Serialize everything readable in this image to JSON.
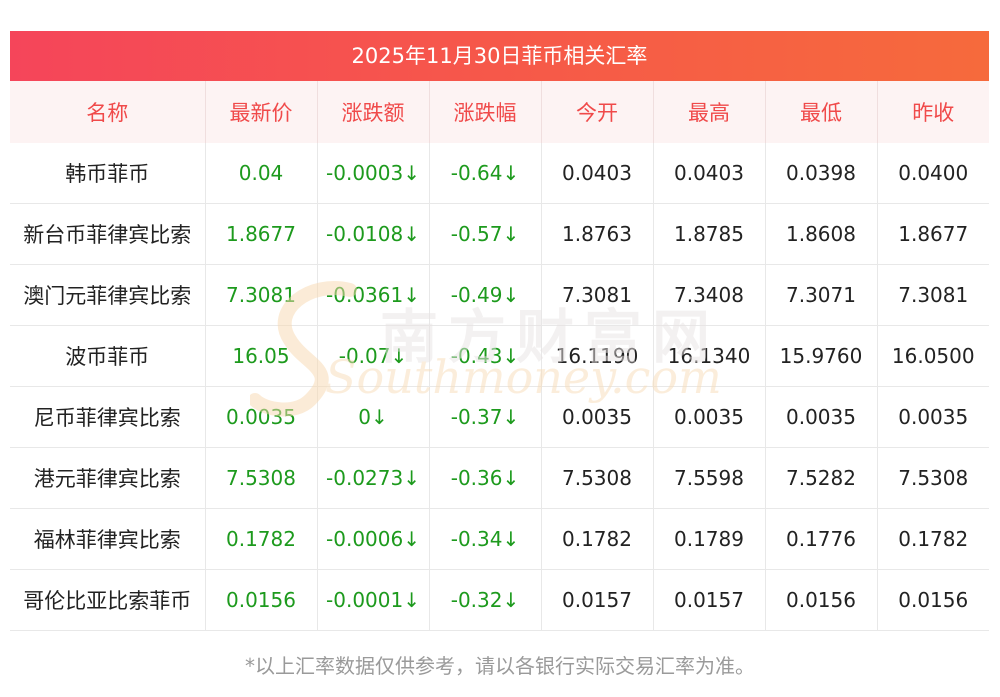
{
  "title": "2025年11月30日菲币相关汇率",
  "headers": [
    "名称",
    "最新价",
    "涨跌额",
    "涨跌幅",
    "今开",
    "最高",
    "最低",
    "昨收"
  ],
  "rows": [
    {
      "name": "韩币菲币",
      "latest": "0.04",
      "change": "-0.0003↓",
      "change_pct": "-0.64↓",
      "open": "0.0403",
      "high": "0.0403",
      "low": "0.0398",
      "prev_close": "0.0400"
    },
    {
      "name": "新台币菲律宾比索",
      "latest": "1.8677",
      "change": "-0.0108↓",
      "change_pct": "-0.57↓",
      "open": "1.8763",
      "high": "1.8785",
      "low": "1.8608",
      "prev_close": "1.8677"
    },
    {
      "name": "澳门元菲律宾比索",
      "latest": "7.3081",
      "change": "-0.0361↓",
      "change_pct": "-0.49↓",
      "open": "7.3081",
      "high": "7.3408",
      "low": "7.3071",
      "prev_close": "7.3081"
    },
    {
      "name": "波币菲币",
      "latest": "16.05",
      "change": "-0.07↓",
      "change_pct": "-0.43↓",
      "open": "16.1190",
      "high": "16.1340",
      "low": "15.9760",
      "prev_close": "16.0500"
    },
    {
      "name": "尼币菲律宾比索",
      "latest": "0.0035",
      "change": "0↓",
      "change_pct": "-0.37↓",
      "open": "0.0035",
      "high": "0.0035",
      "low": "0.0035",
      "prev_close": "0.0035"
    },
    {
      "name": "港元菲律宾比索",
      "latest": "7.5308",
      "change": "-0.0273↓",
      "change_pct": "-0.36↓",
      "open": "7.5308",
      "high": "7.5598",
      "low": "7.5282",
      "prev_close": "7.5308"
    },
    {
      "name": "福林菲律宾比索",
      "latest": "0.1782",
      "change": "-0.0006↓",
      "change_pct": "-0.34↓",
      "open": "0.1782",
      "high": "0.1789",
      "low": "0.1776",
      "prev_close": "0.1782"
    },
    {
      "name": "哥伦比亚比索菲币",
      "latest": "0.0156",
      "change": "-0.0001↓",
      "change_pct": "-0.32↓",
      "open": "0.0157",
      "high": "0.0157",
      "low": "0.0156",
      "prev_close": "0.0156"
    }
  ],
  "footnote": "*以上汇率数据仅供参考，请以各银行实际交易汇率为准。",
  "watermark": {
    "cn": "南方财富网",
    "en": "Southmoney.com"
  },
  "colors": {
    "header_bar": "#f5455a",
    "header_text": "#f04a4a",
    "up_down_green": "#1d9a1d"
  }
}
